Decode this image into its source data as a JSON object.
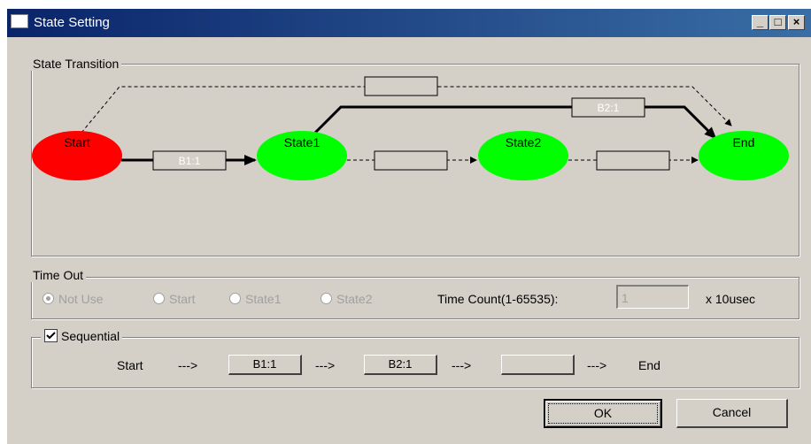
{
  "window": {
    "title": "State Setting"
  },
  "state_transition": {
    "label": "State Transition",
    "states": {
      "start": "Start",
      "state1": "State1",
      "state2": "State2",
      "end": "End"
    },
    "edges": {
      "start_state1": "B1:1",
      "state1_state2": "",
      "state2_end": "",
      "start_end": "",
      "state1_end": "B2:1"
    },
    "colors": {
      "start": "#ff0000",
      "state": "#00ff00"
    }
  },
  "timeout": {
    "label": "Time Out",
    "options": [
      "Not Use",
      "Start",
      "State1",
      "State2"
    ],
    "selected": "Not Use",
    "count_label": "Time Count(1-65535):",
    "count_value": "1",
    "unit": "x 10usec"
  },
  "sequential": {
    "label": "Sequential",
    "checked": true,
    "start": "Start",
    "arrow": "--->",
    "steps": [
      "B1:1",
      "B2:1",
      ""
    ],
    "end": "End"
  },
  "buttons": {
    "ok": "OK",
    "cancel": "Cancel"
  }
}
